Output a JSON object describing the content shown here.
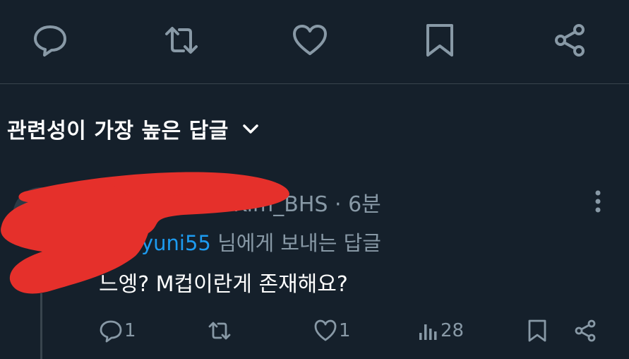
{
  "top_actions": {
    "icons": [
      "reply-icon",
      "retweet-icon",
      "like-icon",
      "bookmark-icon",
      "share-icon"
    ]
  },
  "sort": {
    "label": "관련성이 가장 높은 답글",
    "icon": "chevron-down-icon"
  },
  "reply": {
    "username": "Kim_BHS",
    "separator": "·",
    "time": "6분",
    "reply_to_handle": "yuni55",
    "reply_to_suffix": "님에게 보내는 답글",
    "text": "느엥? M컵이란게 존재해요?",
    "actions": {
      "reply_count": "1",
      "like_count": "1",
      "view_count": "28"
    }
  },
  "colors": {
    "background": "#15202b",
    "divider": "#38444d",
    "secondary_text": "#8899a6",
    "link": "#1d9bf0",
    "redaction": "#e5302b"
  }
}
